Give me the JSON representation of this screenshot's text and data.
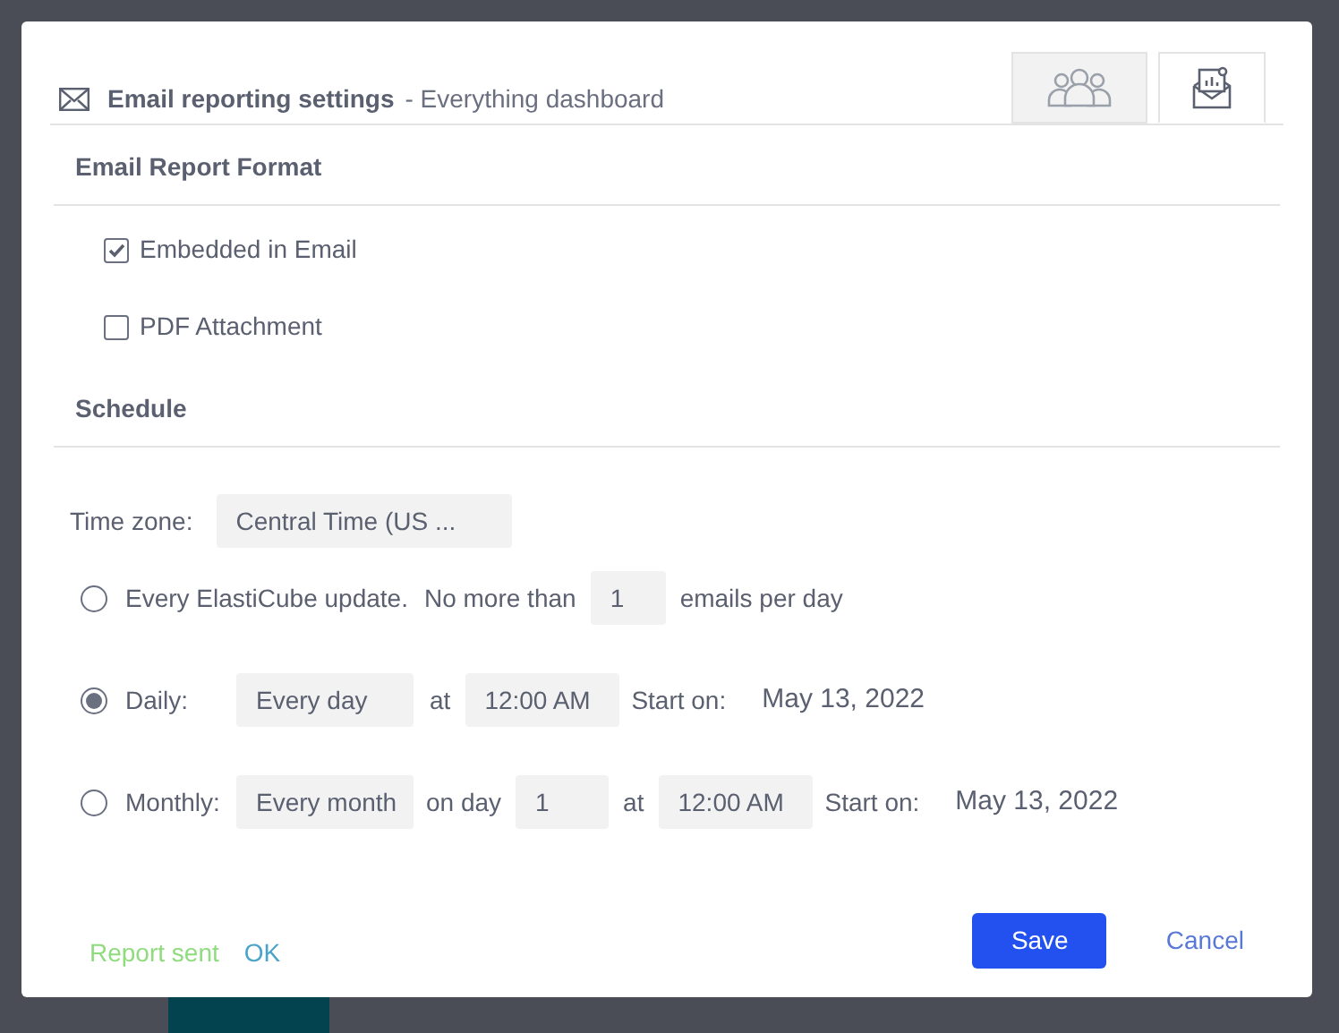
{
  "header": {
    "title": "Email reporting settings",
    "subtitle": "- Everything dashboard"
  },
  "tabs": [
    {
      "kind": "people",
      "selected": false
    },
    {
      "kind": "report",
      "selected": true
    }
  ],
  "format": {
    "heading": "Email Report Format",
    "options": [
      {
        "label": "Embedded in Email",
        "checked": true
      },
      {
        "label": "PDF Attachment",
        "checked": false
      }
    ]
  },
  "schedule": {
    "heading": "Schedule",
    "timezone_label": "Time zone:",
    "timezone_value": "Central Time (US ...",
    "options": [
      {
        "kind": "update",
        "selected": false,
        "label": "Every ElastiCube update.",
        "limit_label": "No more than",
        "limit_value": "1",
        "limit_suffix": "emails per day"
      },
      {
        "kind": "daily",
        "selected": true,
        "label": "Daily:",
        "frequency": "Every day",
        "at_label": "at",
        "time": "12:00 AM",
        "start_label": "Start on:",
        "start_date": "May 13, 2022"
      },
      {
        "kind": "monthly",
        "selected": false,
        "label": "Monthly:",
        "frequency": "Every month",
        "day_label": "on day",
        "day": "1",
        "at_label": "at",
        "time": "12:00 AM",
        "start_label": "Start on:",
        "start_date": "May 13, 2022"
      }
    ]
  },
  "footer": {
    "status": "Report sent",
    "ok": "OK",
    "save": "Save",
    "cancel": "Cancel"
  }
}
